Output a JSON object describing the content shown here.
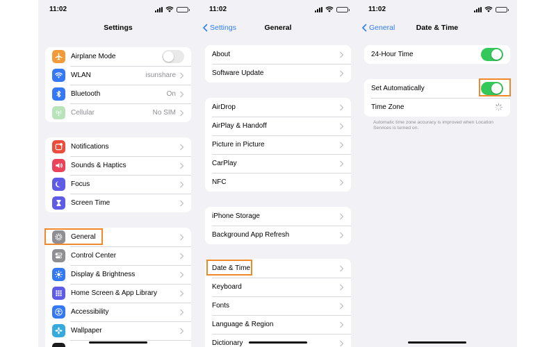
{
  "status": {
    "time": "11:02"
  },
  "colors": {
    "accent": "#2f7cf6",
    "toggle_on": "#34c759",
    "highlight": "#f0882a"
  },
  "screen1": {
    "title": "Settings",
    "group1": [
      {
        "label": "Airplane Mode",
        "icon": "airplane-icon",
        "color": "#f19a37",
        "toggle": "off"
      },
      {
        "label": "WLAN",
        "value": "isunshare",
        "icon": "wifi-icon",
        "color": "#3478f6"
      },
      {
        "label": "Bluetooth",
        "value": "On",
        "icon": "bluetooth-icon",
        "color": "#3478f6"
      },
      {
        "label": "Cellular",
        "value": "No SIM",
        "icon": "cellular-icon",
        "color": "#65c466"
      }
    ],
    "group2": [
      {
        "label": "Notifications",
        "icon": "notifications-icon",
        "color": "#eb4d3d"
      },
      {
        "label": "Sounds & Haptics",
        "icon": "speaker-icon",
        "color": "#eb445a"
      },
      {
        "label": "Focus",
        "icon": "moon-icon",
        "color": "#5e5ce6"
      },
      {
        "label": "Screen Time",
        "icon": "hourglass-icon",
        "color": "#5e5ce6"
      }
    ],
    "group3": [
      {
        "label": "General",
        "icon": "gear-icon",
        "color": "#8e8e93"
      },
      {
        "label": "Control Center",
        "icon": "control-center-icon",
        "color": "#8e8e93"
      },
      {
        "label": "Display & Brightness",
        "icon": "brightness-icon",
        "color": "#3478f6"
      },
      {
        "label": "Home Screen & App Library",
        "icon": "home-screen-icon",
        "color": "#5e5ce6"
      },
      {
        "label": "Accessibility",
        "icon": "accessibility-icon",
        "color": "#3478f6"
      },
      {
        "label": "Wallpaper",
        "icon": "wallpaper-icon",
        "color": "#36aadc"
      }
    ]
  },
  "screen2": {
    "back_label": "Settings",
    "title": "General",
    "group1": [
      "About",
      "Software Update"
    ],
    "group2": [
      "AirDrop",
      "AirPlay & Handoff",
      "Picture in Picture",
      "CarPlay",
      "NFC"
    ],
    "group3": [
      "iPhone Storage",
      "Background App Refresh"
    ],
    "group4": [
      "Date & Time",
      "Keyboard",
      "Fonts",
      "Language & Region",
      "Dictionary"
    ]
  },
  "screen3": {
    "back_label": "General",
    "title": "Date & Time",
    "hour24_label": "24-Hour Time",
    "hour24_state": "on",
    "auto_label": "Set Automatically",
    "auto_state": "on",
    "timezone_label": "Time Zone",
    "footnote": "Automatic time zone accuracy is improved when Location Services is turned on."
  }
}
